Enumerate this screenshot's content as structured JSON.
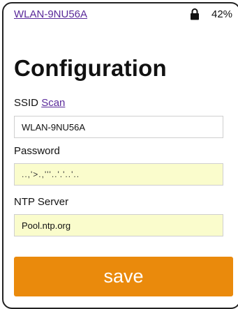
{
  "status_bar": {
    "network_name": "WLAN-9NU56A",
    "battery_level": "42%",
    "lock_icon": "lock-icon"
  },
  "page": {
    "title": "Configuration"
  },
  "form": {
    "ssid": {
      "label": "SSID",
      "scan_link": "Scan",
      "value": "WLAN-9NU56A"
    },
    "password": {
      "label": "Password",
      "value": "..,'>.,'''..'.'..'.."
    },
    "ntp": {
      "label": "NTP Server",
      "value": "Pool.ntp.org"
    },
    "save_label": "save"
  },
  "colors": {
    "link": "#5a2a9a",
    "button": "#ea8a0c",
    "field_highlight": "#fafccc"
  }
}
